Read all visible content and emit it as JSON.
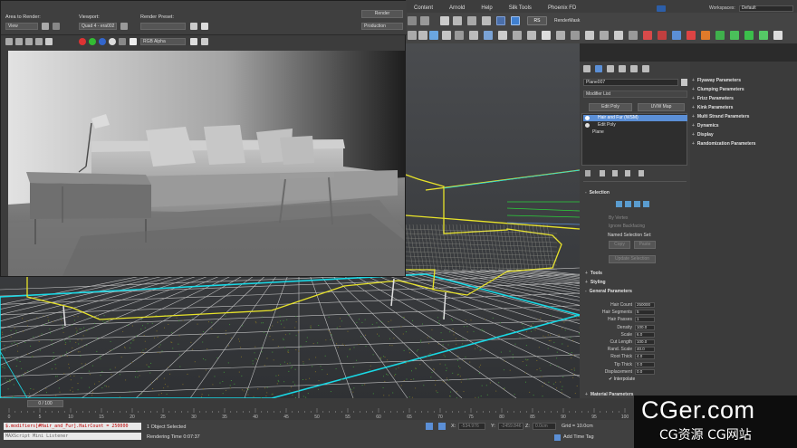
{
  "menubar": [
    "Content",
    "Arnold",
    "Help",
    "Silk Tools",
    "Phoenix FD"
  ],
  "workspaces": {
    "label": "Workspaces:",
    "value": "Default"
  },
  "render_setup": {
    "area_label": "Area to Render:",
    "area_value": "View",
    "viewport_label": "Viewport:",
    "viewport_value": "Quad 4 - era002",
    "preset_label": "Render Preset:",
    "preset_value": "",
    "render_button": "Render",
    "production_value": "Production",
    "channel_value": "RGB Alpha"
  },
  "toolbar": {
    "rendermask_label": "RenderMask",
    "rs_label": "RS"
  },
  "command_panel": {
    "object_name": "Plane007",
    "modifier_list": "Modifier List",
    "edit_poly_button": "Edit Poly",
    "uvw_map_button": "UVW Map",
    "stack": [
      "Hair and Fur (WSM)",
      "Edit Poly",
      "Plane"
    ],
    "selection": {
      "header": "Selection",
      "by_vertex": "By Vertex",
      "ignore_backfacing": "Ignore Backfacing",
      "named_selection_set": "Named Selection Set:",
      "copy": "Copy",
      "paste": "Paste",
      "update_selection": "Update Selection"
    },
    "rollouts_collapsed": [
      "Tools",
      "Styling"
    ],
    "general_header": "General Parameters",
    "general_params": [
      {
        "label": "Hair Count",
        "value": "250000"
      },
      {
        "label": "Hair Segments",
        "value": "5"
      },
      {
        "label": "Hair Passes",
        "value": "1"
      },
      {
        "label": "Density",
        "value": "100.0"
      },
      {
        "label": "Scale",
        "value": "6.0"
      },
      {
        "label": "Cut Length",
        "value": "100.0"
      },
      {
        "label": "Rand. Scale",
        "value": "40.0"
      },
      {
        "label": "Root Thick",
        "value": "4.0"
      },
      {
        "label": "Tip Thick",
        "value": "0.0"
      },
      {
        "label": "Displacement",
        "value": "0.0"
      }
    ],
    "interpolate": "Interpolate",
    "material_header": "Material Parameters",
    "right_rollouts": [
      "Flyaway Parameters",
      "Clumping Parameters",
      "Frizz Parameters",
      "Kink Parameters",
      "Multi Strand Parameters",
      "Dynamics",
      "Display",
      "Randomization Parameters"
    ]
  },
  "timeline": {
    "slider": "0 / 100",
    "ticks": [
      "0",
      "5",
      "10",
      "15",
      "20",
      "25",
      "30",
      "35",
      "40",
      "45",
      "50",
      "55",
      "60",
      "65",
      "70",
      "75",
      "80",
      "85",
      "90",
      "95",
      "100"
    ]
  },
  "status": {
    "maxscript_line": "$.modifiers[#Hair_and_Fur].HairCount = 250000",
    "listener": "MAXScript Mini Listener",
    "objects_selected": "1 Object Selected",
    "rendering_time": "Rendering Time 0:07:37",
    "x_label": "X:",
    "x_value": "-534.976",
    "y_label": "Y:",
    "y_value": "-2459.846",
    "z_label": "Z:",
    "z_value": "0.0cm",
    "grid": "Grid = 10.0cm",
    "add_time_tag": "Add Time Tag"
  },
  "watermark": {
    "line1": "CGer.com",
    "line2": "CG资源 CG网站"
  },
  "colors": {
    "wire_yellow": "#e8e32a",
    "wire_cyan": "#19d9e6",
    "wire_green": "#2bd13a",
    "grid_white": "#d8d8d8",
    "select_blue": "#5b8fd6"
  }
}
